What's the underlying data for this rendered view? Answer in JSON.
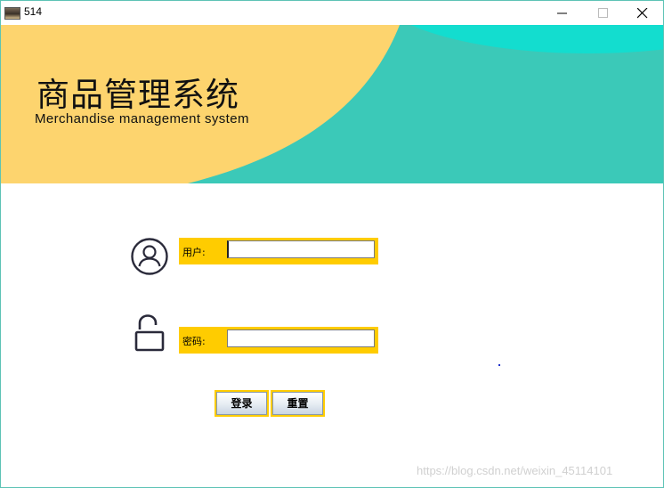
{
  "window": {
    "title": "514",
    "controls": {
      "minimize": "minimize-icon",
      "maximize": "maximize-icon",
      "close": "close-icon"
    }
  },
  "banner": {
    "title": "商品管理系统",
    "subtitle": "Merchandise management system",
    "colors": {
      "yellow": "#fdd46e",
      "teal": "#3bc9b8",
      "cyan": "#13ddcf"
    }
  },
  "form": {
    "username": {
      "label": "用户:",
      "value": "",
      "icon": "user-circle-icon"
    },
    "password": {
      "label": "密码:",
      "value": "",
      "icon": "unlock-icon"
    },
    "field_background": "#ffcc00"
  },
  "buttons": {
    "login_label": "登录",
    "reset_label": "重置"
  },
  "watermark": "https://blog.csdn.net/weixin_45114101"
}
